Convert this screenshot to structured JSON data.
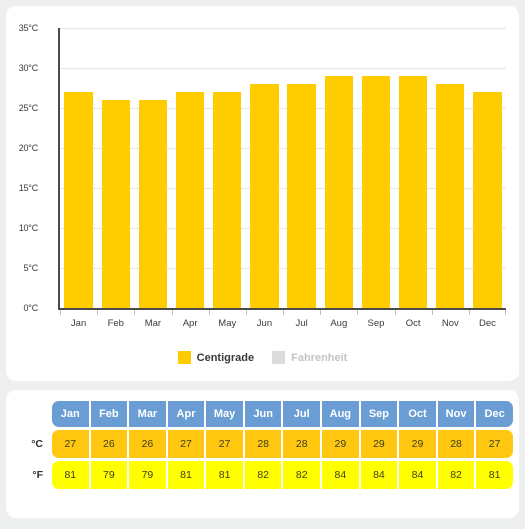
{
  "chart_data": {
    "type": "bar",
    "title": "",
    "xlabel": "",
    "ylabel": "",
    "categories": [
      "Jan",
      "Feb",
      "Mar",
      "Apr",
      "May",
      "Jun",
      "Jul",
      "Aug",
      "Sep",
      "Oct",
      "Nov",
      "Dec"
    ],
    "series": [
      {
        "name": "Centigrade",
        "unit": "°C",
        "color": "#ffcc00",
        "active": true,
        "values": [
          27,
          26,
          26,
          27,
          27,
          28,
          28,
          29,
          29,
          29,
          28,
          27
        ]
      },
      {
        "name": "Fahrenheit",
        "unit": "°F",
        "color": "#dcdcdc",
        "active": false,
        "values": [
          81,
          79,
          79,
          81,
          81,
          82,
          82,
          84,
          84,
          84,
          82,
          81
        ]
      }
    ],
    "ylim": [
      0,
      35
    ],
    "ytick_step": 5,
    "ytick_labels": [
      "0°C",
      "5°C",
      "10°C",
      "15°C",
      "20°C",
      "25°C",
      "30°C",
      "35°C"
    ],
    "ytick_values": [
      0,
      5,
      10,
      15,
      20,
      25,
      30,
      35
    ],
    "grid": true,
    "legend_position": "bottom"
  },
  "legend": {
    "items": [
      {
        "label": "Centigrade",
        "active": true
      },
      {
        "label": "Fahrenheit",
        "active": false
      }
    ]
  },
  "table": {
    "headers": [
      "Jan",
      "Feb",
      "Mar",
      "Apr",
      "May",
      "Jun",
      "Jul",
      "Aug",
      "Sep",
      "Oct",
      "Nov",
      "Dec"
    ],
    "rows": [
      {
        "label": "°C",
        "values": [
          "27",
          "26",
          "26",
          "27",
          "27",
          "28",
          "28",
          "29",
          "29",
          "29",
          "28",
          "27"
        ]
      },
      {
        "label": "°F",
        "values": [
          "81",
          "79",
          "79",
          "81",
          "81",
          "82",
          "82",
          "84",
          "84",
          "84",
          "82",
          "81"
        ]
      }
    ]
  },
  "colors": {
    "bar": "#ffcc00",
    "header": "#6a9dd3",
    "celsius_row": "#ffc70f",
    "fahrenheit_row": "#ffff00",
    "background": "#eef0f0",
    "card": "#ffffff"
  }
}
